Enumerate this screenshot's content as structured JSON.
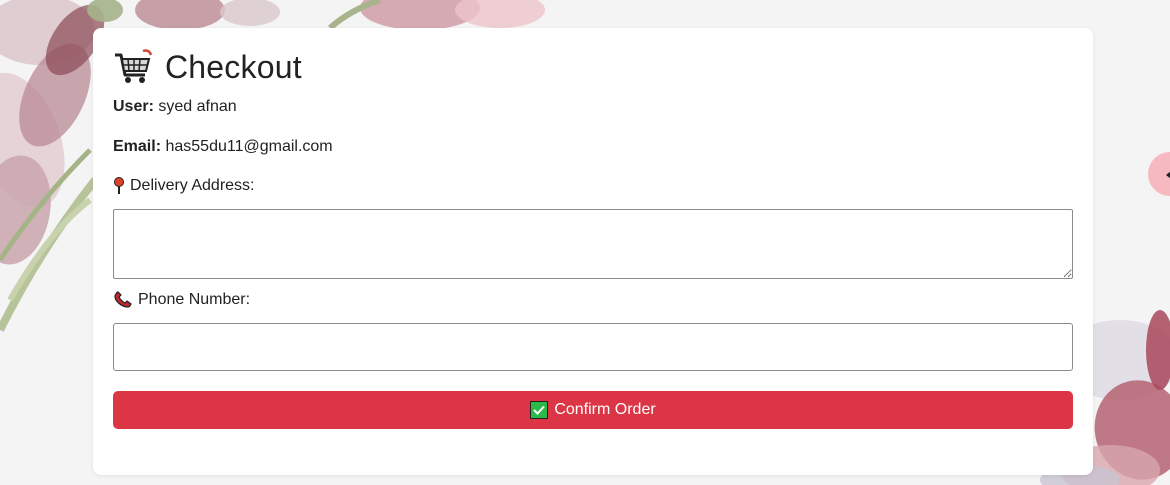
{
  "checkout": {
    "title": "Checkout",
    "icon": "shopping-cart-icon",
    "user_label": "User:",
    "user_value": "syed afnan",
    "email_label": "Email:",
    "email_value": "has55du11@gmail.com",
    "address_label": "Delivery Address:",
    "address_icon": "pushpin-icon",
    "address_value": "",
    "phone_label": "Phone Number:",
    "phone_icon": "telephone-receiver-icon",
    "phone_value": "",
    "confirm_label": "Confirm Order",
    "confirm_icon": "check-mark-button-icon"
  },
  "colors": {
    "accent": "#dc3545",
    "side_tab": "#f7b9c1",
    "background": "#f4f4f5"
  }
}
